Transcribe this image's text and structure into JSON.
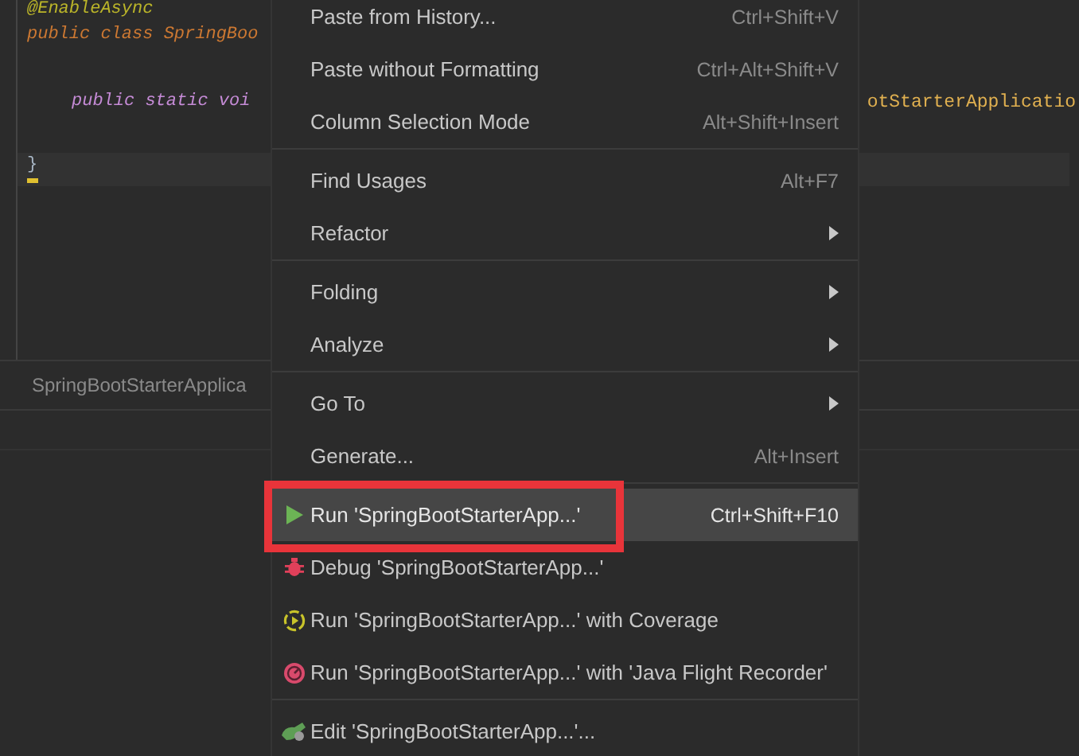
{
  "editor": {
    "lines": [
      {
        "kind": "annotation",
        "left": "@EnableAsync"
      },
      {
        "kind": "class",
        "left": "public class SpringBoo"
      },
      {
        "kind": "blank"
      },
      {
        "kind": "method",
        "left": "public static voi",
        "right": "otStarterApplicatio"
      },
      {
        "kind": "blank"
      },
      {
        "kind": "caret",
        "left": "}"
      }
    ]
  },
  "tab": {
    "label": "SpringBootStarterApplica"
  },
  "context_menu": {
    "groups": [
      [
        {
          "kind": "plain",
          "label": "Paste from History...",
          "shortcut": "Ctrl+Shift+V",
          "submenu": false,
          "selected": false,
          "highlighted": false
        },
        {
          "kind": "plain",
          "label": "Paste without Formatting",
          "shortcut": "Ctrl+Alt+Shift+V",
          "submenu": false,
          "selected": false,
          "highlighted": false
        },
        {
          "kind": "plain",
          "label": "Column Selection Mode",
          "shortcut": "Alt+Shift+Insert",
          "submenu": false,
          "selected": false,
          "highlighted": false
        }
      ],
      [
        {
          "kind": "plain",
          "label": "Find Usages",
          "shortcut": "Alt+F7",
          "submenu": false,
          "selected": false,
          "highlighted": false
        },
        {
          "kind": "plain",
          "label": "Refactor",
          "submenu": true,
          "selected": false,
          "highlighted": false
        }
      ],
      [
        {
          "kind": "plain",
          "label": "Folding",
          "submenu": true,
          "selected": false,
          "highlighted": false
        },
        {
          "kind": "plain",
          "label": "Analyze",
          "submenu": true,
          "selected": false,
          "highlighted": false
        }
      ],
      [
        {
          "kind": "plain",
          "label": "Go To",
          "submenu": true,
          "selected": false,
          "highlighted": false
        },
        {
          "kind": "plain",
          "label": "Generate...",
          "shortcut": "Alt+Insert",
          "submenu": false,
          "selected": false,
          "highlighted": false
        }
      ],
      [
        {
          "kind": "run",
          "label": "Run 'SpringBootStarterApp...'",
          "shortcut": "Ctrl+Shift+F10",
          "submenu": false,
          "selected": true,
          "highlighted": true
        },
        {
          "kind": "debug",
          "label": "Debug 'SpringBootStarterApp...'",
          "submenu": false,
          "selected": false,
          "highlighted": false
        },
        {
          "kind": "coverage",
          "label": "Run 'SpringBootStarterApp...' with Coverage",
          "submenu": false,
          "selected": false,
          "highlighted": false
        },
        {
          "kind": "profiler",
          "label": "Run 'SpringBootStarterApp...' with 'Java Flight Recorder'",
          "submenu": false,
          "selected": false,
          "highlighted": false
        }
      ],
      [
        {
          "kind": "edit",
          "label": "Edit 'SpringBootStarterApp...'...",
          "submenu": false,
          "selected": false,
          "highlighted": false
        }
      ]
    ]
  }
}
